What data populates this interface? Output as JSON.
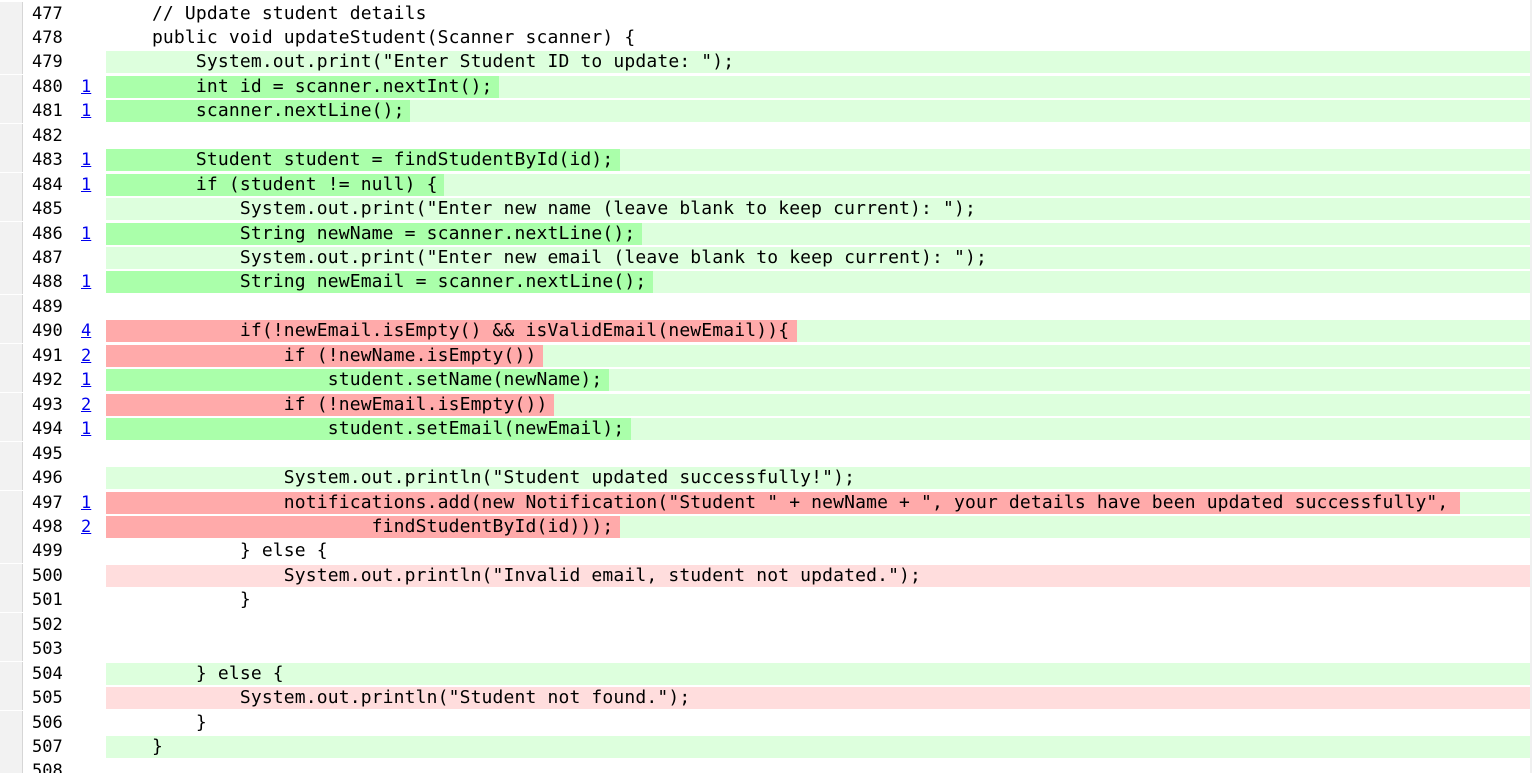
{
  "colors": {
    "covered_line": "#ddffdd",
    "killed_code": "#aaffaa",
    "uncovered_line": "#ffdddd",
    "survived_code": "#ffaaaa",
    "gutter": "#f2f2f2",
    "link": "#0000ee"
  },
  "lines": [
    {
      "num": "477",
      "code": "    // Update student details",
      "mutations": "",
      "status": "none"
    },
    {
      "num": "478",
      "code": "    public void updateStudent(Scanner scanner) {",
      "mutations": "",
      "status": "none"
    },
    {
      "num": "479",
      "code": "        System.out.print(\"Enter Student ID to update: \");",
      "mutations": "",
      "status": "covered"
    },
    {
      "num": "480",
      "code": "        int id = scanner.nextInt();",
      "mutations": "1",
      "status": "killed"
    },
    {
      "num": "481",
      "code": "        scanner.nextLine();",
      "mutations": "1",
      "status": "killed"
    },
    {
      "num": "482",
      "code": "",
      "mutations": "",
      "status": "none"
    },
    {
      "num": "483",
      "code": "        Student student = findStudentById(id);",
      "mutations": "1",
      "status": "killed"
    },
    {
      "num": "484",
      "code": "        if (student != null) {",
      "mutations": "1",
      "status": "killed"
    },
    {
      "num": "485",
      "code": "            System.out.print(\"Enter new name (leave blank to keep current): \");",
      "mutations": "",
      "status": "covered"
    },
    {
      "num": "486",
      "code": "            String newName = scanner.nextLine();",
      "mutations": "1",
      "status": "killed"
    },
    {
      "num": "487",
      "code": "            System.out.print(\"Enter new email (leave blank to keep current): \");",
      "mutations": "",
      "status": "covered"
    },
    {
      "num": "488",
      "code": "            String newEmail = scanner.nextLine();",
      "mutations": "1",
      "status": "killed"
    },
    {
      "num": "489",
      "code": "",
      "mutations": "",
      "status": "none"
    },
    {
      "num": "490",
      "code": "            if(!newEmail.isEmpty() && isValidEmail(newEmail)){",
      "mutations": "4",
      "status": "survived"
    },
    {
      "num": "491",
      "code": "                if (!newName.isEmpty())",
      "mutations": "2",
      "status": "survived"
    },
    {
      "num": "492",
      "code": "                    student.setName(newName);",
      "mutations": "1",
      "status": "killed"
    },
    {
      "num": "493",
      "code": "                if (!newEmail.isEmpty())",
      "mutations": "2",
      "status": "survived"
    },
    {
      "num": "494",
      "code": "                    student.setEmail(newEmail);",
      "mutations": "1",
      "status": "killed"
    },
    {
      "num": "495",
      "code": "",
      "mutations": "",
      "status": "none"
    },
    {
      "num": "496",
      "code": "                System.out.println(\"Student updated successfully!\");",
      "mutations": "",
      "status": "covered"
    },
    {
      "num": "497",
      "code": "                notifications.add(new Notification(\"Student \" + newName + \", your details have been updated successfully\",",
      "mutations": "1",
      "status": "survived"
    },
    {
      "num": "498",
      "code": "                        findStudentById(id)));",
      "mutations": "2",
      "status": "survived"
    },
    {
      "num": "499",
      "code": "            } else {",
      "mutations": "",
      "status": "none"
    },
    {
      "num": "500",
      "code": "                System.out.println(\"Invalid email, student not updated.\");",
      "mutations": "",
      "status": "uncovered"
    },
    {
      "num": "501",
      "code": "            }",
      "mutations": "",
      "status": "none"
    },
    {
      "num": "502",
      "code": "",
      "mutations": "",
      "status": "none"
    },
    {
      "num": "503",
      "code": "",
      "mutations": "",
      "status": "none"
    },
    {
      "num": "504",
      "code": "        } else {",
      "mutations": "",
      "status": "covered"
    },
    {
      "num": "505",
      "code": "            System.out.println(\"Student not found.\");",
      "mutations": "",
      "status": "uncovered"
    },
    {
      "num": "506",
      "code": "        }",
      "mutations": "",
      "status": "none"
    },
    {
      "num": "507",
      "code": "    }",
      "mutations": "",
      "status": "covered"
    },
    {
      "num": "508",
      "code": "",
      "mutations": "",
      "status": "none"
    }
  ]
}
